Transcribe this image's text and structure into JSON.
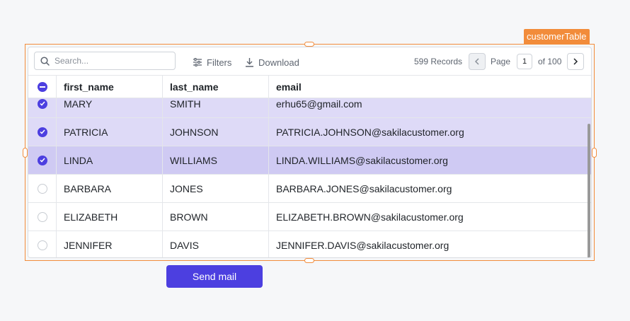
{
  "component": {
    "name": "customerTable"
  },
  "toolbar": {
    "search_placeholder": "Search...",
    "filters_label": "Filters",
    "download_label": "Download",
    "records_text": "599 Records",
    "page_label": "Page",
    "page_value": "1",
    "page_of": "of 100"
  },
  "table": {
    "columns": [
      "first_name",
      "last_name",
      "email"
    ],
    "rows": [
      {
        "selected": true,
        "first_name": "MARY",
        "last_name": "SMITH",
        "email": "erhu65@gmail.com"
      },
      {
        "selected": true,
        "first_name": "PATRICIA",
        "last_name": "JOHNSON",
        "email": "PATRICIA.JOHNSON@sakilacustomer.org"
      },
      {
        "selected": true,
        "first_name": "LINDA",
        "last_name": "WILLIAMS",
        "email": "LINDA.WILLIAMS@sakilacustomer.org"
      },
      {
        "selected": false,
        "first_name": "BARBARA",
        "last_name": "JONES",
        "email": "BARBARA.JONES@sakilacustomer.org"
      },
      {
        "selected": false,
        "first_name": "ELIZABETH",
        "last_name": "BROWN",
        "email": "ELIZABETH.BROWN@sakilacustomer.org"
      },
      {
        "selected": false,
        "first_name": "JENNIFER",
        "last_name": "DAVIS",
        "email": "JENNIFER.DAVIS@sakilacustomer.org"
      }
    ]
  },
  "actions": {
    "send_mail_label": "Send mail"
  },
  "colors": {
    "accent": "#4c3fe0",
    "selection_frame": "#f28c3b",
    "selected_row": "#dedaf7",
    "selected_row_active": "#cfcaf3"
  }
}
